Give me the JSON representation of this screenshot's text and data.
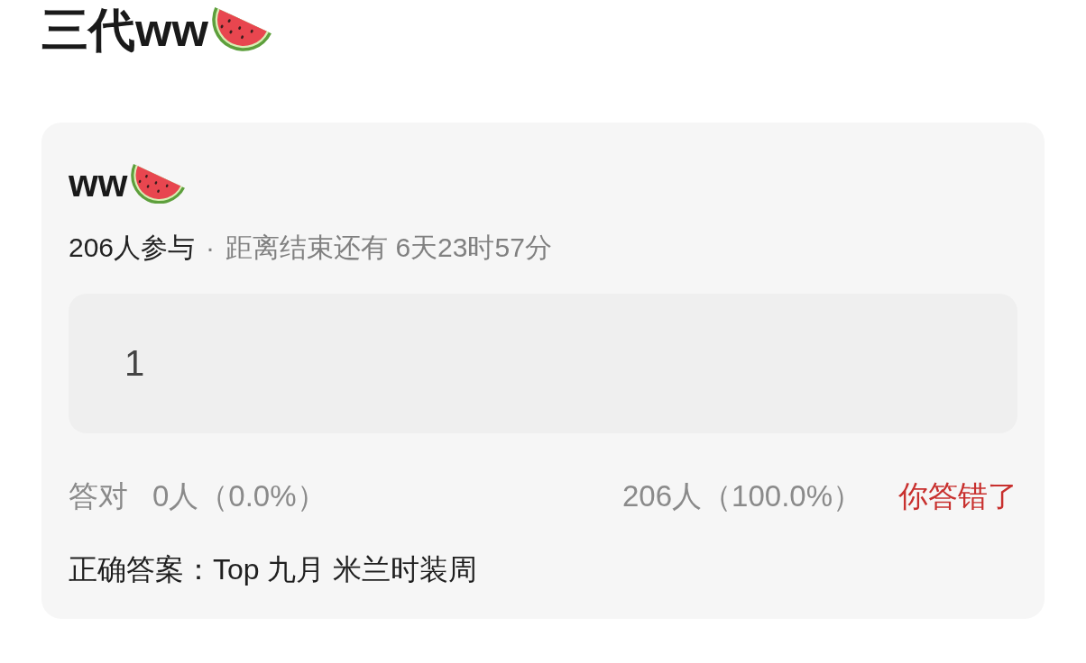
{
  "page_title": "三代ww",
  "quiz": {
    "title": "ww",
    "participants": "206人参与",
    "separator": "·",
    "countdown": "距离结束还有 6天23时57分"
  },
  "answer_field": {
    "value": "1"
  },
  "stats": {
    "correct_label": "答对",
    "correct_count": "0人（0.0%）",
    "wrong_count": "206人（100.0%）",
    "verdict": "你答错了",
    "user_correct": false
  },
  "correct_answer": "正确答案：Top 九月 米兰时装周"
}
